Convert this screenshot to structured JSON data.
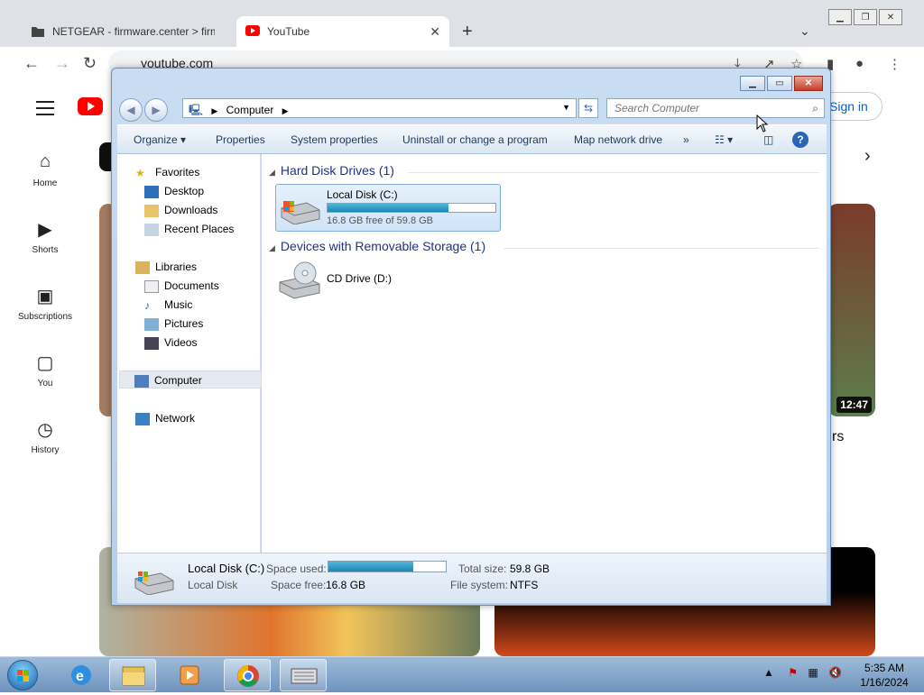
{
  "browser": {
    "tabs": [
      {
        "label": "NETGEAR - firmware.center > firm",
        "active": false
      },
      {
        "label": "YouTube",
        "active": true
      }
    ],
    "url": "youtube.com"
  },
  "youtube": {
    "sidebar": [
      {
        "label": "Home",
        "icon": "home-icon"
      },
      {
        "label": "Shorts",
        "icon": "shorts-icon"
      },
      {
        "label": "Subscriptions",
        "icon": "subscriptions-icon"
      },
      {
        "label": "You",
        "icon": "you-icon"
      },
      {
        "label": "History",
        "icon": "history-icon"
      }
    ],
    "sign_in": "Sign in",
    "video_duration": "12:47",
    "partial_title": "rs"
  },
  "explorer": {
    "address": "Computer",
    "search_placeholder": "Search Computer",
    "commands": [
      "Organize",
      "Properties",
      "System properties",
      "Uninstall or change a program",
      "Map network drive"
    ],
    "more": "»",
    "nav": {
      "favorites": "Favorites",
      "favorite_items": [
        "Desktop",
        "Downloads",
        "Recent Places"
      ],
      "libraries": "Libraries",
      "library_items": [
        "Documents",
        "Music",
        "Pictures",
        "Videos"
      ],
      "computer": "Computer",
      "network": "Network"
    },
    "groups": {
      "hdd": "Hard Disk Drives (1)",
      "removable": "Devices with Removable Storage (1)"
    },
    "drives": {
      "c_name": "Local Disk (C:)",
      "c_free": "16.8 GB free of 59.8 GB",
      "c_used_fraction": 0.72,
      "d_name": "CD Drive (D:)"
    },
    "details": {
      "name": "Local Disk (C:)",
      "type": "Local Disk",
      "space_used_label": "Space used:",
      "space_free_label": "Space free:",
      "space_free": "16.8 GB",
      "total_size_label": "Total size:",
      "total_size": "59.8 GB",
      "file_system_label": "File system:",
      "file_system": "NTFS"
    }
  },
  "taskbar": {
    "time": "5:35 AM",
    "date": "1/16/2024"
  },
  "colors": {
    "youtube_red": "#ff0000",
    "explorer_frame": "#c9ddf2",
    "taskbar": "#6f93bd"
  }
}
